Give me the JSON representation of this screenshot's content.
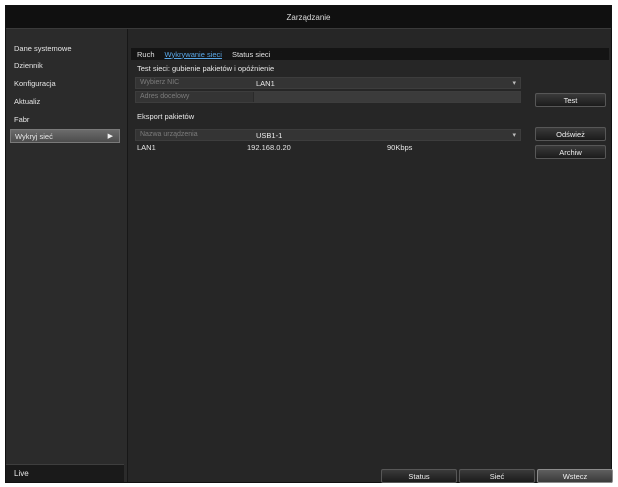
{
  "window": {
    "title": "Zarządzanie"
  },
  "sidebar": {
    "items": [
      {
        "label": "Dane systemowe"
      },
      {
        "label": "Dziennik"
      },
      {
        "label": "Konfiguracja"
      },
      {
        "label": "Aktualiz"
      },
      {
        "label": "Fabr"
      },
      {
        "label": "Wykryj sieć"
      }
    ],
    "active_index": 5,
    "live_label": "Live"
  },
  "tabs": [
    {
      "label": "Ruch"
    },
    {
      "label": "Wykrywanie sieci"
    },
    {
      "label": "Status sieci"
    }
  ],
  "test_section": {
    "title": "Test sieci: gubienie pakietów i opóźnienie",
    "nic_label": "Wybierz NIC",
    "nic_value": "LAN1",
    "address_label": "Adres docelowy",
    "address_value": "",
    "test_button": "Test"
  },
  "export_section": {
    "title": "Eksport pakietów",
    "device_label": "Nazwa urządzenia",
    "device_value": "USB1-1",
    "refresh_button": "Odśwież",
    "archive_button": "Archiw",
    "row": {
      "iface": "LAN1",
      "ip": "192.168.0.20",
      "rate": "90Kbps"
    }
  },
  "bottom_buttons": {
    "status": "Status",
    "network": "Sieć",
    "exit": "Wstecz"
  }
}
